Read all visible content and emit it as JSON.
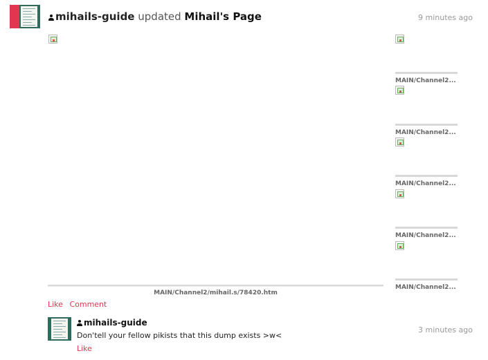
{
  "post": {
    "author": "mihails-guide",
    "verb": "updated",
    "target": "Mihail's Page",
    "timestamp": "9 minutes ago",
    "main_caption": "MAIN/Channel2/mihail.s/78420.htm",
    "side_captions": [
      "MAIN/Channel2...",
      "MAIN/Channel2...",
      "MAIN/Channel2...",
      "MAIN/Channel2...",
      "MAIN/Channel2..."
    ],
    "actions": {
      "like": "Like",
      "comment": "Comment"
    }
  },
  "comment": {
    "author": "mihails-guide",
    "text": "Don'tell your fellow pikists that this dump exists >w<",
    "timestamp": "3 minutes ago",
    "like": "Like"
  },
  "colors": {
    "link": "#e0364f",
    "avatar_green": "#2f6b5a",
    "avatar_red": "#e0364f",
    "timestamp": "#999999"
  },
  "icons": {
    "author": "person-icon",
    "image_placeholder": "broken-image-icon"
  }
}
